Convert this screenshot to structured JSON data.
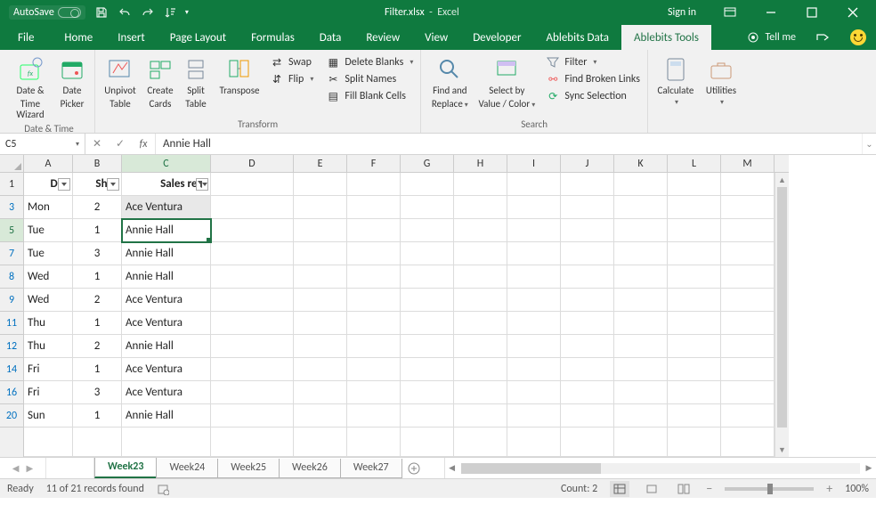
{
  "titlebar": {
    "autosave_label": "AutoSave",
    "autosave_state": "Off",
    "filename": "Filter.xlsx",
    "app": "Excel",
    "signin": "Sign in"
  },
  "tabs": [
    "File",
    "Home",
    "Insert",
    "Page Layout",
    "Formulas",
    "Data",
    "Review",
    "View",
    "Developer",
    "Ablebits Data",
    "Ablebits Tools"
  ],
  "active_tab": "Ablebits Tools",
  "tellme": "Tell me",
  "ribbon": {
    "groups": {
      "datetime": {
        "label": "Date & Time",
        "date_time_wizard_l1": "Date &",
        "date_time_wizard_l2": "Time Wizard",
        "date_picker_l1": "Date",
        "date_picker_l2": "Picker"
      },
      "transform": {
        "label": "Transform",
        "unpivot_l1": "Unpivot",
        "unpivot_l2": "Table",
        "cards_l1": "Create",
        "cards_l2": "Cards",
        "split_l1": "Split",
        "split_l2": "Table",
        "transpose": "Transpose",
        "swap": "Swap",
        "flip": "Flip",
        "delete_blanks": "Delete Blanks",
        "split_names": "Split Names",
        "fill_blank": "Fill Blank Cells"
      },
      "search": {
        "label": "Search",
        "find_l1": "Find and",
        "find_l2": "Replace",
        "select_l1": "Select by",
        "select_l2": "Value / Color",
        "filter": "Filter",
        "find_broken": "Find Broken Links",
        "sync_sel": "Sync Selection"
      },
      "calc": {
        "calculate": "Calculate",
        "utilities": "Utilities"
      }
    }
  },
  "formula_bar": {
    "namebox": "C5",
    "formula": "Annie Hall"
  },
  "columns": [
    {
      "l": "A",
      "w": 55
    },
    {
      "l": "B",
      "w": 55
    },
    {
      "l": "C",
      "w": 100
    },
    {
      "l": "D",
      "w": 93
    },
    {
      "l": "E",
      "w": 60
    },
    {
      "l": "F",
      "w": 60
    },
    {
      "l": "G",
      "w": 60
    },
    {
      "l": "H",
      "w": 60
    },
    {
      "l": "I",
      "w": 60
    },
    {
      "l": "J",
      "w": 60
    },
    {
      "l": "K",
      "w": 60
    },
    {
      "l": "L",
      "w": 60
    },
    {
      "l": "M",
      "w": 60
    }
  ],
  "header_row": {
    "num": 1,
    "day": "Day",
    "shift": "Shift",
    "rep": "Sales rep."
  },
  "rows": [
    {
      "num": 3,
      "day": "Mon",
      "shift": 2,
      "rep": "Ace Ventura"
    },
    {
      "num": 5,
      "day": "Tue",
      "shift": 1,
      "rep": "Annie Hall"
    },
    {
      "num": 7,
      "day": "Tue",
      "shift": 3,
      "rep": "Annie Hall"
    },
    {
      "num": 8,
      "day": "Wed",
      "shift": 1,
      "rep": "Annie Hall"
    },
    {
      "num": 9,
      "day": "Wed",
      "shift": 2,
      "rep": "Ace Ventura"
    },
    {
      "num": 11,
      "day": "Thu",
      "shift": 1,
      "rep": "Ace Ventura"
    },
    {
      "num": 12,
      "day": "Thu",
      "shift": 2,
      "rep": "Annie Hall"
    },
    {
      "num": 14,
      "day": "Fri",
      "shift": 1,
      "rep": "Ace Ventura"
    },
    {
      "num": 16,
      "day": "Fri",
      "shift": 3,
      "rep": "Ace Ventura"
    },
    {
      "num": 20,
      "day": "Sun",
      "shift": 1,
      "rep": "Annie Hall"
    }
  ],
  "sheets": [
    "Week23",
    "Week24",
    "Week25",
    "Week26",
    "Week27"
  ],
  "active_sheet": "Week23",
  "status": {
    "ready": "Ready",
    "records": "11 of 21 records found",
    "count_label": "Count: 2",
    "zoom": "100%"
  },
  "selected_col": "C",
  "selected_row_num": 5,
  "range_row_num": 3
}
